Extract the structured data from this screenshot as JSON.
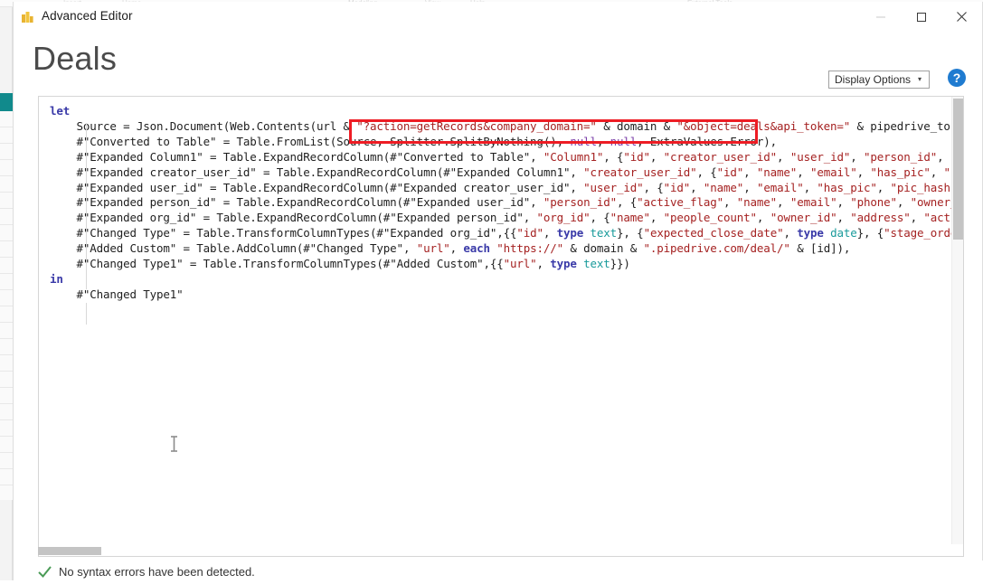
{
  "window": {
    "title": "Advanced Editor",
    "app_icon": "power-bi-icon",
    "controls": {
      "minimize": "–",
      "maximize": "□",
      "close": "✕"
    }
  },
  "header": {
    "page_title": "Deals",
    "display_options_label": "Display Options",
    "display_options_caret": "▾",
    "help_label": "?"
  },
  "editor": {
    "language": "M (Power Query)",
    "code_lines": [
      "let",
      "    Source = Json.Document(Web.Contents(url & \"?action=getRecords&company_domain=\" & domain & \"&object=deals&api_token=\" & pipedrive_token &",
      "    #\"Converted to Table\" = Table.FromList(Source, Splitter.SplitByNothing(), null, null, ExtraValues.Error),",
      "    #\"Expanded Column1\" = Table.ExpandRecordColumn(#\"Converted to Table\", \"Column1\", {\"id\", \"creator_user_id\", \"user_id\", \"person_id\", \"org_i",
      "    #\"Expanded creator_user_id\" = Table.ExpandRecordColumn(#\"Expanded Column1\", \"creator_user_id\", {\"id\", \"name\", \"email\", \"has_pic\", \"pic_ha",
      "    #\"Expanded user_id\" = Table.ExpandRecordColumn(#\"Expanded creator_user_id\", \"user_id\", {\"id\", \"name\", \"email\", \"has_pic\", \"pic_hash\", \"ac",
      "    #\"Expanded person_id\" = Table.ExpandRecordColumn(#\"Expanded user_id\", \"person_id\", {\"active_flag\", \"name\", \"email\", \"phone\", \"owner_id\",",
      "    #\"Expanded org_id\" = Table.ExpandRecordColumn(#\"Expanded person_id\", \"org_id\", {\"name\", \"people_count\", \"owner_id\", \"address\", \"active_fl",
      "    #\"Changed Type\" = Table.TransformColumnTypes(#\"Expanded org_id\",{{\"id\", type text}, {\"expected_close_date\", type date}, {\"stage_order_nr\"",
      "    #\"Added Custom\" = Table.AddColumn(#\"Changed Type\", \"url\", each \"https://\" & domain & \".pipedrive.com/deal/\" & [id]),",
      "    #\"Changed Type1\" = Table.TransformColumnTypes(#\"Added Custom\",{{\"url\", type text}})",
      "in",
      "    #\"Changed Type1\""
    ],
    "highlighted_fragment": "\"?action=getRecords&company_domain=\" & domain & \"&object=deals",
    "annotation_color": "#ee1c24",
    "scrollbars": {
      "vertical": "vertical-scrollbar",
      "horizontal": "horizontal-scrollbar"
    }
  },
  "status": {
    "icon": "green-check-icon",
    "message": "No syntax errors have been detected.",
    "icon_color": "#4a9b56"
  },
  "backdrop": {
    "ghost_labels": [
      "Insert",
      "Home",
      "Modeling",
      "View",
      "Help",
      "External Tools"
    ]
  },
  "syntax_colors": {
    "keyword": "#3a3aa8",
    "string": "#a52222",
    "literal": "#7a3ea8",
    "type": "#1a9b9b",
    "plain": "#1f1f1f"
  }
}
